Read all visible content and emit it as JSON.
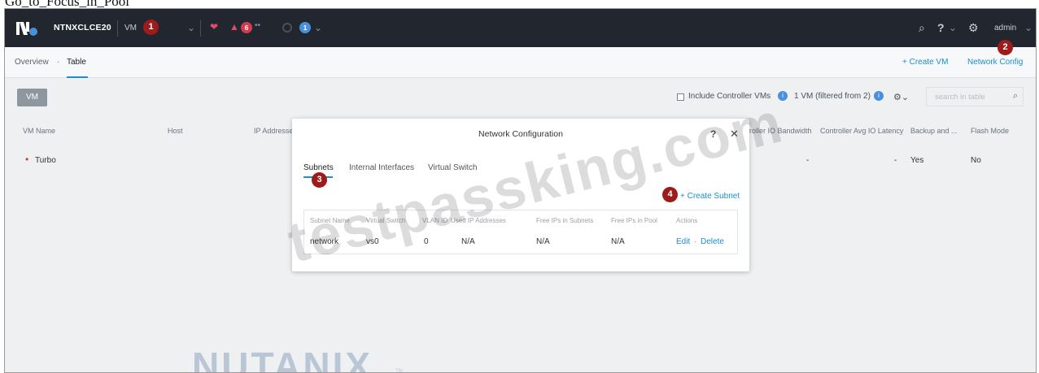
{
  "caption": "Go_to_Focus_in_Pool",
  "topbar": {
    "cluster_name": "NTNXCLCE20",
    "vm_menu": "VM",
    "marker_vm": "1",
    "alert_count": "6",
    "task_count": "1",
    "user": "admin",
    "accent_color": "#1b8ed0",
    "alert_color": "#e04a6a"
  },
  "subheader": {
    "breadcrumb": [
      "Overview",
      "·",
      "Table"
    ],
    "create_vm": "+ Create VM",
    "network_config": "Network Config",
    "marker_network": "2"
  },
  "toolbar": {
    "vm_button": "VM",
    "include_controller": "Include Controller VMs",
    "vm_count": "1 VM (filtered from 2)",
    "search_placeholder": "search in table"
  },
  "table": {
    "headers": [
      "VM Name",
      "Host",
      "IP Addresses",
      "Controller IO Bandwidth",
      "Controller Avg IO Latency",
      "Backup and ...",
      "Flash Mode"
    ],
    "rows": [
      {
        "name": "Turbo",
        "bandwidth": "-",
        "latency": "-",
        "backup": "Yes",
        "flash": "No"
      }
    ]
  },
  "modal": {
    "title": "Network Configuration",
    "tabs": [
      "Subnets",
      "Internal Interfaces",
      "Virtual Switch"
    ],
    "marker_tab": "3",
    "marker_create": "4",
    "create_subnet": "+ Create Subnet",
    "columns": [
      "Subnet Name",
      "Virtual Switch",
      "VLAN ID",
      "Used IP Addresses",
      "Free IPs in Subnets",
      "Free IPs in Pool",
      "Actions"
    ],
    "row": {
      "name": "network",
      "switch": "vs0",
      "vlan": "0",
      "used": "N/A",
      "free_subnets": "N/A",
      "free_pool": "N/A",
      "edit": "Edit",
      "dot": "·",
      "delete": "Delete"
    }
  },
  "watermarks": {
    "site": "testpassking.com",
    "brand": "NUTANIX",
    "tm": "TM"
  }
}
